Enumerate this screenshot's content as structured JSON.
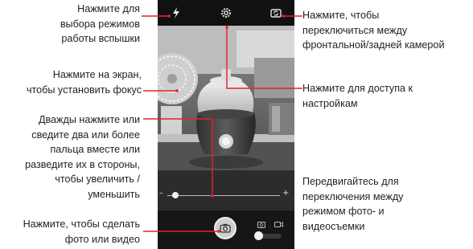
{
  "callouts": {
    "flash": "Нажмите для\nвыбора режимов\nработы вспышки",
    "switch_camera": "Нажмите, чтобы\nпереключиться между\nфронтальной/задней камерой",
    "focus": "Нажмите на экран,\nчтобы установить фокус",
    "settings": "Нажмите для доступа к\nнастройкам",
    "zoom": "Дважды нажмите или\nсведите два или более\nпальца вместе или\nразведите их в стороны,\nчтобы увеличить /\nуменьшить",
    "mode_switch": "Передвигайтесь для\nпереключения между\nрежимом фото- и\nвидеосъемки",
    "shutter": "Нажмите, чтобы сделать\nфото или видео"
  },
  "camera": {
    "zoom_min_label": "–",
    "zoom_max_label": "+",
    "zoom_level": 0.07,
    "mode": "photo"
  },
  "icons": {
    "flash": "flash-icon",
    "settings": "gear-icon",
    "switch_camera": "switch-camera-icon",
    "shutter": "camera-icon",
    "photo_mode": "camera-icon",
    "video_mode": "video-icon"
  },
  "colors": {
    "leader": "#e8202a",
    "text": "#231f20"
  }
}
